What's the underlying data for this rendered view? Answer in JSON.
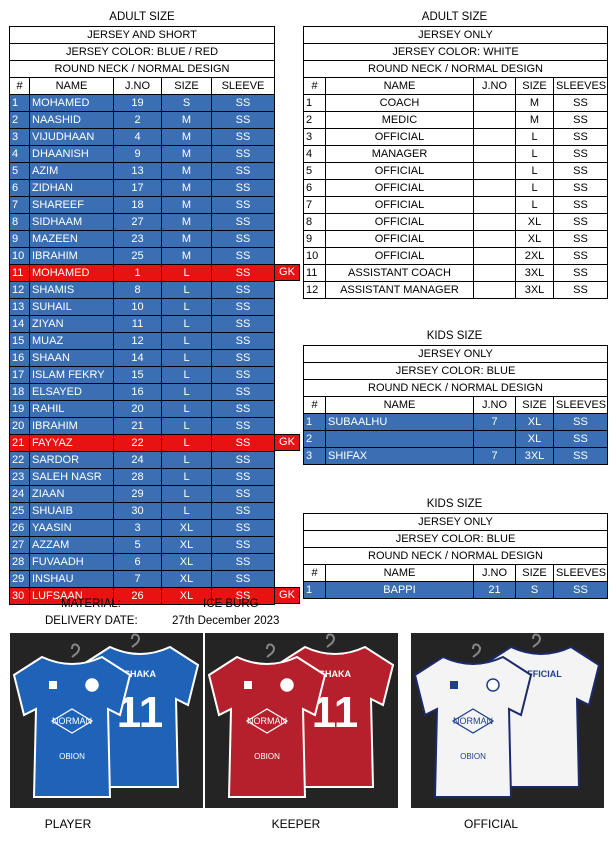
{
  "adult_left": {
    "caption": "ADULT SIZE",
    "headers": [
      "JERSEY AND SHORT",
      "JERSEY COLOR: BLUE / RED",
      "ROUND NECK / NORMAL DESIGN"
    ],
    "columns": [
      "#",
      "NAME",
      "J.NO",
      "SIZE",
      "SLEEVE"
    ],
    "rows": [
      {
        "no": "1",
        "name": "MOHAMED",
        "jno": "19",
        "size": "S",
        "sleeve": "SS",
        "color": "blue",
        "tag": ""
      },
      {
        "no": "2",
        "name": "NAASHID",
        "jno": "2",
        "size": "M",
        "sleeve": "SS",
        "color": "blue",
        "tag": ""
      },
      {
        "no": "3",
        "name": "VIJUDHAAN",
        "jno": "4",
        "size": "M",
        "sleeve": "SS",
        "color": "blue",
        "tag": ""
      },
      {
        "no": "4",
        "name": "DHAANISH",
        "jno": "9",
        "size": "M",
        "sleeve": "SS",
        "color": "blue",
        "tag": ""
      },
      {
        "no": "5",
        "name": "AZIM",
        "jno": "13",
        "size": "M",
        "sleeve": "SS",
        "color": "blue",
        "tag": ""
      },
      {
        "no": "6",
        "name": "ZIDHAN",
        "jno": "17",
        "size": "M",
        "sleeve": "SS",
        "color": "blue",
        "tag": ""
      },
      {
        "no": "7",
        "name": "SHAREEF",
        "jno": "18",
        "size": "M",
        "sleeve": "SS",
        "color": "blue",
        "tag": ""
      },
      {
        "no": "8",
        "name": "SIDHAAM",
        "jno": "27",
        "size": "M",
        "sleeve": "SS",
        "color": "blue",
        "tag": ""
      },
      {
        "no": "9",
        "name": "MAZEEN",
        "jno": "23",
        "size": "M",
        "sleeve": "SS",
        "color": "blue",
        "tag": ""
      },
      {
        "no": "10",
        "name": "IBRAHIM",
        "jno": "25",
        "size": "M",
        "sleeve": "SS",
        "color": "blue",
        "tag": ""
      },
      {
        "no": "11",
        "name": "MOHAMED",
        "jno": "1",
        "size": "L",
        "sleeve": "SS",
        "color": "red",
        "tag": "GK"
      },
      {
        "no": "12",
        "name": "SHAMIS",
        "jno": "8",
        "size": "L",
        "sleeve": "SS",
        "color": "blue",
        "tag": ""
      },
      {
        "no": "13",
        "name": "SUHAIL",
        "jno": "10",
        "size": "L",
        "sleeve": "SS",
        "color": "blue",
        "tag": ""
      },
      {
        "no": "14",
        "name": "ZIYAN",
        "jno": "11",
        "size": "L",
        "sleeve": "SS",
        "color": "blue",
        "tag": ""
      },
      {
        "no": "15",
        "name": "MUAZ",
        "jno": "12",
        "size": "L",
        "sleeve": "SS",
        "color": "blue",
        "tag": ""
      },
      {
        "no": "16",
        "name": "SHAAN",
        "jno": "14",
        "size": "L",
        "sleeve": "SS",
        "color": "blue",
        "tag": ""
      },
      {
        "no": "17",
        "name": "ISLAM FEKRY",
        "jno": "15",
        "size": "L",
        "sleeve": "SS",
        "color": "blue",
        "tag": ""
      },
      {
        "no": "18",
        "name": "ELSAYED",
        "jno": "16",
        "size": "L",
        "sleeve": "SS",
        "color": "blue",
        "tag": ""
      },
      {
        "no": "19",
        "name": "RAHIL",
        "jno": "20",
        "size": "L",
        "sleeve": "SS",
        "color": "blue",
        "tag": ""
      },
      {
        "no": "20",
        "name": "IBRAHIM",
        "jno": "21",
        "size": "L",
        "sleeve": "SS",
        "color": "blue",
        "tag": ""
      },
      {
        "no": "21",
        "name": "FAYYAZ",
        "jno": "22",
        "size": "L",
        "sleeve": "SS",
        "color": "red",
        "tag": "GK"
      },
      {
        "no": "22",
        "name": "SARDOR",
        "jno": "24",
        "size": "L",
        "sleeve": "SS",
        "color": "blue",
        "tag": ""
      },
      {
        "no": "23",
        "name": "SALEH NASR",
        "jno": "28",
        "size": "L",
        "sleeve": "SS",
        "color": "blue",
        "tag": ""
      },
      {
        "no": "24",
        "name": "ZIAAN",
        "jno": "29",
        "size": "L",
        "sleeve": "SS",
        "color": "blue",
        "tag": ""
      },
      {
        "no": "25",
        "name": "SHUAIB",
        "jno": "30",
        "size": "L",
        "sleeve": "SS",
        "color": "blue",
        "tag": ""
      },
      {
        "no": "26",
        "name": "YAASIN",
        "jno": "3",
        "size": "XL",
        "sleeve": "SS",
        "color": "blue",
        "tag": ""
      },
      {
        "no": "27",
        "name": "AZZAM",
        "jno": "5",
        "size": "XL",
        "sleeve": "SS",
        "color": "blue",
        "tag": ""
      },
      {
        "no": "28",
        "name": "FUVAADH",
        "jno": "6",
        "size": "XL",
        "sleeve": "SS",
        "color": "blue",
        "tag": ""
      },
      {
        "no": "29",
        "name": "INSHAU",
        "jno": "7",
        "size": "XL",
        "sleeve": "SS",
        "color": "blue",
        "tag": ""
      },
      {
        "no": "30",
        "name": "LUFSAAN",
        "jno": "26",
        "size": "XL",
        "sleeve": "SS",
        "color": "red",
        "tag": "GK"
      }
    ]
  },
  "adult_right": {
    "caption": "ADULT SIZE",
    "headers": [
      "JERSEY ONLY",
      "JERSEY COLOR: WHITE",
      "ROUND NECK / NORMAL DESIGN"
    ],
    "columns": [
      "#",
      "NAME",
      "J.NO",
      "SIZE",
      "SLEEVES"
    ],
    "rows": [
      {
        "no": "1",
        "name": "COACH",
        "jno": "",
        "size": "M",
        "sleeve": "SS",
        "color": "white"
      },
      {
        "no": "2",
        "name": "MEDIC",
        "jno": "",
        "size": "M",
        "sleeve": "SS",
        "color": "white"
      },
      {
        "no": "3",
        "name": "OFFICIAL",
        "jno": "",
        "size": "L",
        "sleeve": "SS",
        "color": "white"
      },
      {
        "no": "4",
        "name": "MANAGER",
        "jno": "",
        "size": "L",
        "sleeve": "SS",
        "color": "white"
      },
      {
        "no": "5",
        "name": "OFFICIAL",
        "jno": "",
        "size": "L",
        "sleeve": "SS",
        "color": "white"
      },
      {
        "no": "6",
        "name": "OFFICIAL",
        "jno": "",
        "size": "L",
        "sleeve": "SS",
        "color": "white"
      },
      {
        "no": "7",
        "name": "OFFICIAL",
        "jno": "",
        "size": "L",
        "sleeve": "SS",
        "color": "white"
      },
      {
        "no": "8",
        "name": "OFFICIAL",
        "jno": "",
        "size": "XL",
        "sleeve": "SS",
        "color": "white"
      },
      {
        "no": "9",
        "name": "OFFICIAL",
        "jno": "",
        "size": "XL",
        "sleeve": "SS",
        "color": "white"
      },
      {
        "no": "10",
        "name": "OFFICIAL",
        "jno": "",
        "size": "2XL",
        "sleeve": "SS",
        "color": "white"
      },
      {
        "no": "11",
        "name": "ASSISTANT COACH",
        "jno": "",
        "size": "3XL",
        "sleeve": "SS",
        "color": "white"
      },
      {
        "no": "12",
        "name": "ASSISTANT MANAGER",
        "jno": "",
        "size": "3XL",
        "sleeve": "SS",
        "color": "white"
      }
    ]
  },
  "kids_1": {
    "caption": "KIDS SIZE",
    "headers": [
      "JERSEY ONLY",
      "JERSEY COLOR: BLUE",
      "ROUND NECK / NORMAL DESIGN"
    ],
    "columns": [
      "#",
      "NAME",
      "J.NO",
      "SIZE",
      "SLEEVES"
    ],
    "rows": [
      {
        "no": "1",
        "name": "SUBAALHU",
        "jno": "7",
        "size": "XL",
        "sleeve": "SS",
        "color": "blue"
      },
      {
        "no": "2",
        "name": "",
        "jno": "",
        "size": "XL",
        "sleeve": "SS",
        "color": "blue"
      },
      {
        "no": "3",
        "name": "SHIFAX",
        "jno": "7",
        "size": "3XL",
        "sleeve": "SS",
        "color": "blue"
      }
    ]
  },
  "kids_2": {
    "caption": "KIDS SIZE",
    "headers": [
      "JERSEY ONLY",
      "JERSEY COLOR: BLUE",
      "ROUND NECK / NORMAL DESIGN"
    ],
    "columns": [
      "#",
      "NAME",
      "J.NO",
      "SIZE",
      "SLEEVES"
    ],
    "rows": [
      {
        "no": "1",
        "name": "BAPPI",
        "jno": "21",
        "size": "S",
        "sleeve": "SS",
        "color": "blue"
      }
    ]
  },
  "meta": {
    "material_label": "MATERIAL:",
    "material_value": "ICE BURG",
    "delivery_label": "DELIVERY DATE:",
    "delivery_value": "27th December 2023"
  },
  "photos": [
    {
      "label": "PLAYER",
      "back_name": "SHAKA",
      "back_number": "11",
      "front_brand": "NORMAN",
      "front_sponsor": "OBION",
      "jersey_color": "#1f63b8",
      "trim_color": "#ffffff",
      "print_color": "#ffffff"
    },
    {
      "label": "KEEPER",
      "back_name": "SHAKA",
      "back_number": "11",
      "front_brand": "NORMAN",
      "front_sponsor": "OBION",
      "jersey_color": "#b5202c",
      "trim_color": "#ffffff",
      "print_color": "#ffffff"
    },
    {
      "label": "OFFICIAL",
      "back_name": "OFFICIAL",
      "back_number": "",
      "front_brand": "NORMAN",
      "front_sponsor": "OBION",
      "jersey_color": "#f4f4f4",
      "trim_color": "#1b2a6b",
      "print_color": "#1f3f8a"
    }
  ]
}
